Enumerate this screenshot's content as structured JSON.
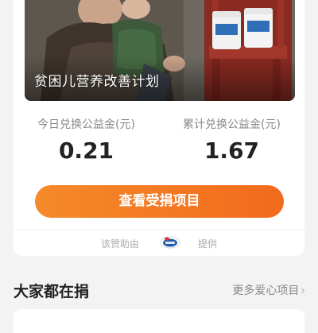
{
  "banner": {
    "title": "贫困儿营养改善计划"
  },
  "stats": {
    "today": {
      "label": "今日兑换公益金(元)",
      "value": "0.21"
    },
    "total": {
      "label": "累计兑换公益金(元)",
      "value": "1.67"
    }
  },
  "cta": {
    "label": "查看受捐项目"
  },
  "sponsor": {
    "prefix": "该赞助由",
    "suffix": "提供",
    "logo_icon": "sponsor-brand-logo"
  },
  "section": {
    "title": "大家都在捐",
    "more_label": "更多爱心项目",
    "more_icon": "chevron-right"
  },
  "colors": {
    "accent": "#f26a1c",
    "background": "#f3f3f3"
  }
}
